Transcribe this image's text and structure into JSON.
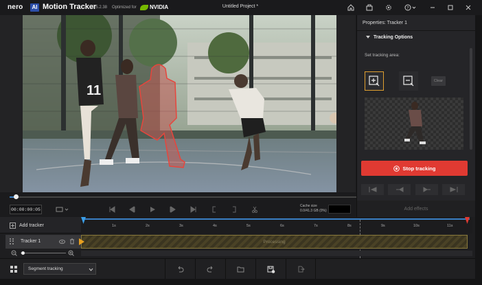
{
  "titlebar": {
    "brand": "nero",
    "ai_badge": "AI",
    "app_name": "Motion Tracker",
    "version": "26.5.2.38",
    "optimized_for": "Optimized for",
    "gpu_brand": "NVIDIA",
    "project_title": "Untitled Project *",
    "icons": [
      "home-icon",
      "share-icon",
      "settings-icon",
      "help-icon",
      "minimize-icon",
      "maximize-icon",
      "close-icon"
    ]
  },
  "panel": {
    "title": "Properties: Tracker 1",
    "section": "Tracking Options",
    "set_area_label": "Set tracking area:",
    "add_area_icon": "add-area-icon",
    "remove_area_icon": "remove-area-icon",
    "clear_label": "Clear",
    "stop_label": "Stop tracking",
    "stop_color": "#e03a32",
    "nav_icons": [
      "skip-start-icon",
      "step-back-icon",
      "step-forward-icon",
      "skip-end-icon"
    ],
    "add_effects": "Add effects"
  },
  "playback": {
    "timecode": "00:00:00:05",
    "cache_label": "Cache size",
    "cache_value": "0.0/41.3 GB (0%)"
  },
  "timeline": {
    "add_tracker": "Add tracker",
    "ticks": [
      "1s",
      "2s",
      "3s",
      "4s",
      "5s",
      "6s",
      "7s",
      "8s",
      "9s",
      "10s",
      "11s"
    ],
    "track_name": "Tracker 1",
    "track_status": "Processing",
    "accent_color": "#3a7fc4"
  },
  "bottombar": {
    "mode": "Segment tracking",
    "icons": [
      "undo-icon",
      "redo-icon",
      "open-folder-icon",
      "save-project-icon",
      "export-icon"
    ]
  }
}
